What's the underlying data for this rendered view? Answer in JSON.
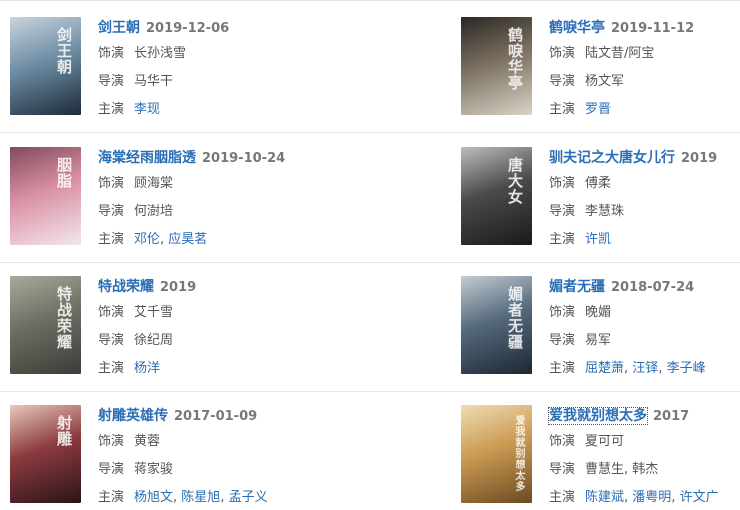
{
  "labels": {
    "role": "饰演",
    "director": "导演",
    "star": "主演"
  },
  "shows": [
    {
      "title": "剑王朝",
      "date": "2019-12-06",
      "role": "长孙浅雪",
      "director": "马华干",
      "stars": [
        "李现"
      ],
      "poster_text": "剑王朝",
      "poster_colors": [
        "#1d2b3a",
        "#6f8ea5",
        "#c9d4de"
      ]
    },
    {
      "title": "鹤唳华亭",
      "date": "2019-11-12",
      "role": "陆文昔/阿宝",
      "director": "杨文军",
      "stars": [
        "罗晋"
      ],
      "poster_text": "鹤唳华亭",
      "poster_colors": [
        "#d9d4c6",
        "#7a6f60",
        "#2b2723"
      ]
    },
    {
      "title": "海棠经雨胭脂透",
      "date": "2019-10-24",
      "role": "顾海棠",
      "director": "何澍培",
      "stars": [
        "邓伦",
        "应昊茗"
      ],
      "poster_text": "胭脂",
      "poster_colors": [
        "#f3e7ea",
        "#d98fa4",
        "#7f4b5a"
      ]
    },
    {
      "title": "驯夫记之大唐女儿行",
      "date": "2019",
      "role": "傅柔",
      "director": "李慧珠",
      "stars": [
        "许凯"
      ],
      "poster_text": "唐大女",
      "poster_colors": [
        "#1a1a1a",
        "#4a4a4a",
        "#bdbdbd"
      ]
    },
    {
      "title": "特战荣耀",
      "date": "2019",
      "role": "艾千雪",
      "director": "徐纪周",
      "stars": [
        "杨洋"
      ],
      "poster_text": "特战荣耀",
      "poster_colors": [
        "#3b3d38",
        "#6c6f63",
        "#a8aa9c"
      ]
    },
    {
      "title": "媚者无疆",
      "date": "2018-07-24",
      "role": "晚媚",
      "director": "易军",
      "stars": [
        "屈楚萧",
        "汪铎",
        "李子峰"
      ],
      "poster_text": "媚者无疆",
      "poster_colors": [
        "#1c2733",
        "#556a7c",
        "#c4ccd3"
      ]
    },
    {
      "title": "射雕英雄传",
      "date": "2017-01-09",
      "role": "黄蓉",
      "director": "蒋家骏",
      "stars": [
        "杨旭文",
        "陈星旭",
        "孟子义"
      ],
      "poster_text": "射雕",
      "poster_colors": [
        "#2a1418",
        "#8c3a3f",
        "#e7c9b8"
      ]
    },
    {
      "title": "爱我就别想太多",
      "date": "2017",
      "role": "夏可可",
      "director": "曹慧生, 韩杰",
      "stars": [
        "陈建斌",
        "潘粤明",
        "许文广"
      ],
      "poster_text": "爱我就别想太多",
      "poster_colors": [
        "#6b4a22",
        "#c99a52",
        "#f1dcb2"
      ]
    }
  ]
}
